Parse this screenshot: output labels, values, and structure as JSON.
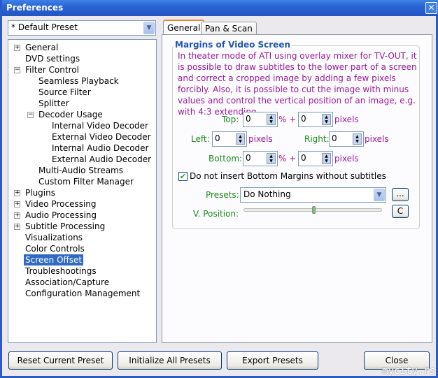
{
  "window": {
    "title": "Preferences",
    "close_icon": "close-icon"
  },
  "preset_combo": {
    "value": "* Default Preset"
  },
  "tree": [
    {
      "label": "General",
      "level": 0,
      "expander": "+"
    },
    {
      "label": "DVD settings",
      "level": 0
    },
    {
      "label": "Filter Control",
      "level": 0,
      "expander": "-"
    },
    {
      "label": "Seamless Playback",
      "level": 1
    },
    {
      "label": "Source Filter",
      "level": 1
    },
    {
      "label": "Splitter",
      "level": 1
    },
    {
      "label": "Decoder Usage",
      "level": 1,
      "expander": "-"
    },
    {
      "label": "Internal Video Decoder",
      "level": 2
    },
    {
      "label": "External Video Decoder",
      "level": 2
    },
    {
      "label": "Internal Audio Decoder",
      "level": 2
    },
    {
      "label": "External Audio Decoder",
      "level": 2
    },
    {
      "label": "Multi-Audio Streams",
      "level": 1
    },
    {
      "label": "Custom Filter Manager",
      "level": 1
    },
    {
      "label": "Plugins",
      "level": 0,
      "expander": "+"
    },
    {
      "label": "Video Processing",
      "level": 0,
      "expander": "+"
    },
    {
      "label": "Audio Processing",
      "level": 0,
      "expander": "+"
    },
    {
      "label": "Subtitle Processing",
      "level": 0,
      "expander": "+"
    },
    {
      "label": "Visualizations",
      "level": 0
    },
    {
      "label": "Color Controls",
      "level": 0
    },
    {
      "label": "Screen Offset",
      "level": 0,
      "selected": true
    },
    {
      "label": "Troubleshootings",
      "level": 0
    },
    {
      "label": "Association/Capture",
      "level": 0
    },
    {
      "label": "Configuration Management",
      "level": 0
    }
  ],
  "tabs": [
    {
      "label": "General",
      "active": true
    },
    {
      "label": "Pan & Scan"
    }
  ],
  "group": {
    "title": "Margins of Video Screen",
    "description": "In theater mode of ATI using overlay mixer for TV-OUT, it is possible to draw subtitles to the lower part of a screen and correct a cropped image by adding a few pixels forcibly. Also, it is possible to cut the image with minus values and control the vertical position of an image, e.g. with 4:3 extending.",
    "top_label": "Top:",
    "top_percent": "0",
    "top_pixels": "0",
    "left_label": "Left:",
    "left_pixels": "0",
    "right_label": "Right:",
    "right_pixels": "0",
    "bottom_label": "Bottom:",
    "bottom_percent": "0",
    "bottom_pixels": "0",
    "percent_plus": "% +",
    "pixels_unit": "pixels",
    "checkbox_label": "Do not insert Bottom Margins without subtitles",
    "checkbox_checked": true,
    "presets_label": "Presets:",
    "presets_value": "Do Nothing",
    "presets_more": "...",
    "vpos_label": "V. Position:",
    "vpos_value_percent": 50,
    "vpos_reset": "C"
  },
  "buttons": {
    "reset": "Reset Current Preset",
    "init": "Initialize All Presets",
    "export": "Export Presets",
    "close": "Close"
  },
  "watermark": "mycity.rs"
}
